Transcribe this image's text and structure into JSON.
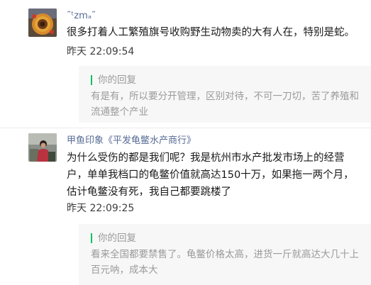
{
  "comments": [
    {
      "nickname": "˜ᵗzmₐ˜",
      "avatar": "avatar-sunflower",
      "content": "很多打着人工繁殖旗号收购野生动物卖的大有人在，特别是蛇。",
      "time": "昨天 22:09:54",
      "reply": {
        "title": "你的回复",
        "text": "有是有，所以要分开管理，区别对待，不可一刀切，苦了养殖和流通整个产业"
      }
    },
    {
      "nickname": "甲鱼印象《平发龟鳖水产商行》",
      "avatar": "avatar-person",
      "content": "为什么受伤的都是我们呢？我是杭州市水产批发市场上的经营户，单单我档口的龟鳖价值就高达150十万，如果拖一两个月，估计龟鳖没有死，我自己都要跳楼了",
      "time": "昨天 22:09:25",
      "reply": {
        "title": "你的回复",
        "text": "看来全国都要禁售了。龟鳖价格太高，进货一斤就高达大几十上百元呐，成本大"
      }
    }
  ],
  "colors": {
    "nickname": "#576b95",
    "reply_accent": "#07c160",
    "reply_background": "#f7f7f7"
  }
}
